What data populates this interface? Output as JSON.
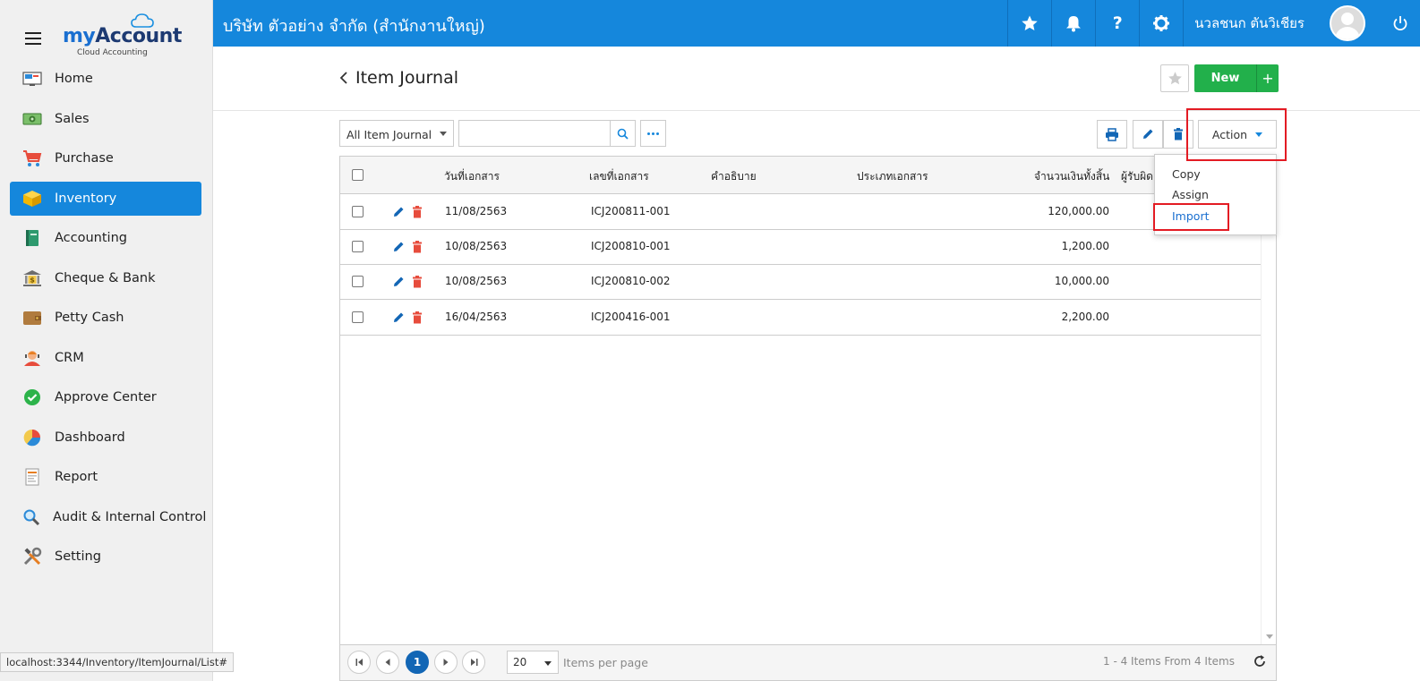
{
  "app": {
    "logo_my": "my",
    "logo_account": "Account",
    "logo_sub": "Cloud Accounting"
  },
  "sidebar": {
    "items": [
      {
        "label": "Home",
        "icon": "home-icon"
      },
      {
        "label": "Sales",
        "icon": "sales-icon"
      },
      {
        "label": "Purchase",
        "icon": "cart-icon"
      },
      {
        "label": "Inventory",
        "icon": "box-icon",
        "active": true
      },
      {
        "label": "Accounting",
        "icon": "book-icon"
      },
      {
        "label": "Cheque & Bank",
        "icon": "bank-icon"
      },
      {
        "label": "Petty Cash",
        "icon": "wallet-icon"
      },
      {
        "label": "CRM",
        "icon": "crm-icon"
      },
      {
        "label": "Approve Center",
        "icon": "check-circle-icon"
      },
      {
        "label": "Dashboard",
        "icon": "pie-chart-icon"
      },
      {
        "label": "Report",
        "icon": "report-icon"
      },
      {
        "label": "Audit & Internal Control",
        "icon": "magnifier-icon"
      },
      {
        "label": "Setting",
        "icon": "tools-icon"
      }
    ]
  },
  "header": {
    "company": "บริษัท ตัวอย่าง จำกัด (สำนักงานใหญ่)",
    "username": "นวลชนก ตันวิเชียร"
  },
  "page": {
    "title": "Item Journal",
    "new_label": "New",
    "plus_label": "+"
  },
  "toolbar": {
    "filter_value": "All Item Journal",
    "search_placeholder": "",
    "action_label": "Action"
  },
  "dropdown": {
    "items": [
      "Copy",
      "Assign",
      "Import"
    ]
  },
  "table": {
    "columns": [
      "วันที่เอกสาร",
      "เลขที่เอกสาร",
      "คำอธิบาย",
      "ประเภทเอกสาร",
      "จำนวนเงินทั้งสิ้น",
      "ผู้รับผิด"
    ],
    "rows": [
      {
        "date": "11/08/2563",
        "doc_no": "ICJ200811-001",
        "description": "",
        "doc_type": "",
        "amount": "120,000.00"
      },
      {
        "date": "10/08/2563",
        "doc_no": "ICJ200810-001",
        "description": "",
        "doc_type": "",
        "amount": "1,200.00"
      },
      {
        "date": "10/08/2563",
        "doc_no": "ICJ200810-002",
        "description": "",
        "doc_type": "",
        "amount": "10,000.00"
      },
      {
        "date": "16/04/2563",
        "doc_no": "ICJ200416-001",
        "description": "",
        "doc_type": "",
        "amount": "2,200.00"
      }
    ]
  },
  "pager": {
    "current_page": "1",
    "per_page": "20",
    "per_page_label": "Items per page",
    "info": "1 - 4 Items From 4 Items"
  },
  "statusbar": {
    "url": "localhost:3344/Inventory/ItemJournal/List#"
  },
  "colors": {
    "primary": "#1587dc",
    "success": "#22b04b",
    "danger": "#e74c3c",
    "highlight": "#e31b23"
  }
}
